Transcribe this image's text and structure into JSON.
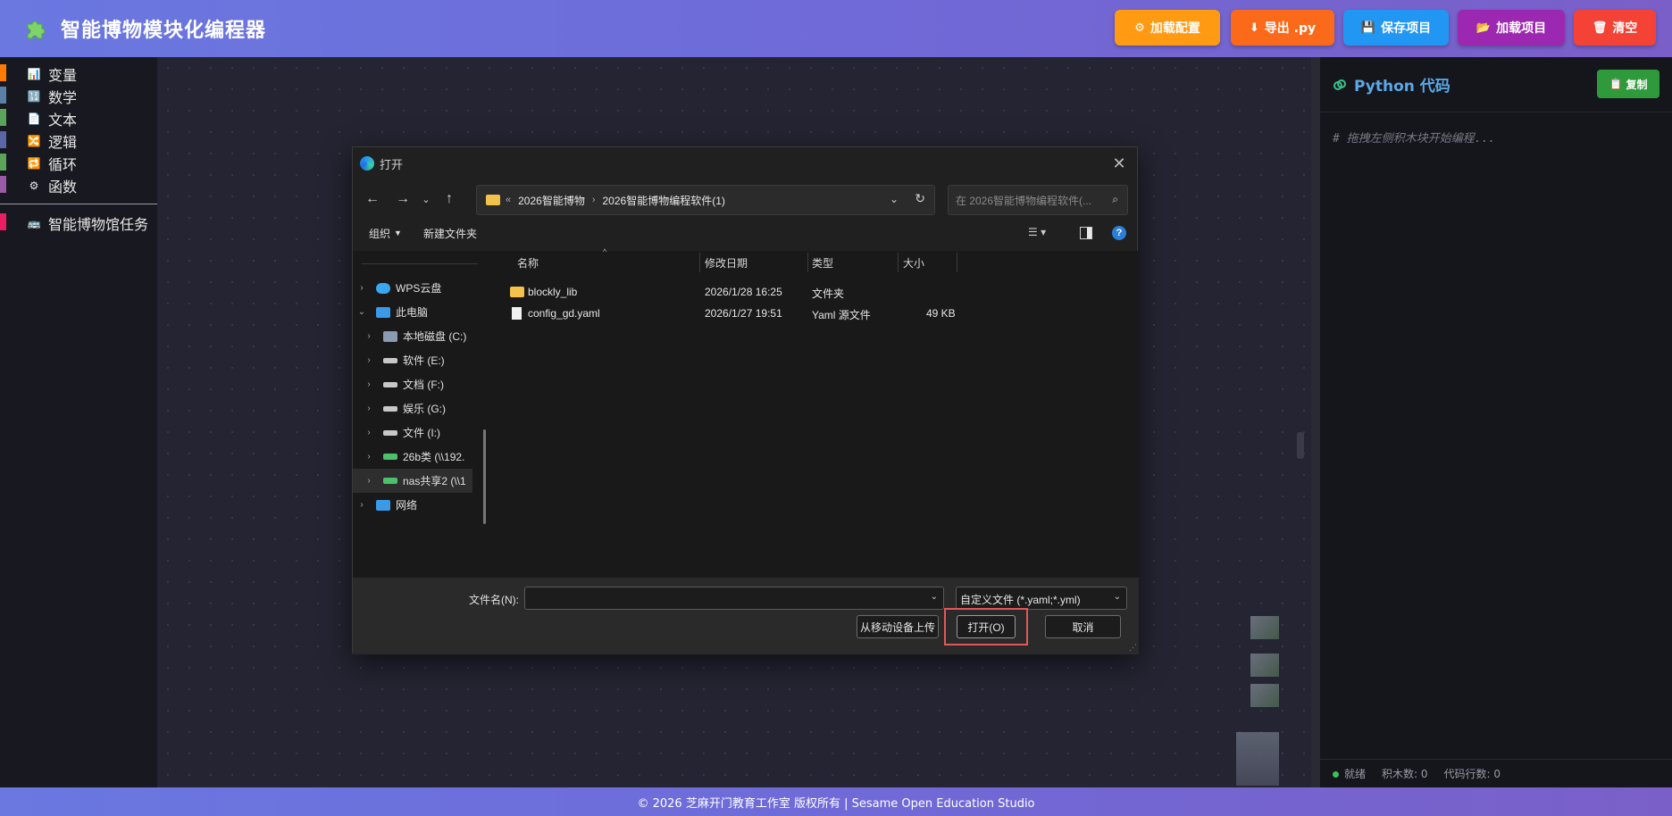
{
  "header": {
    "title": "智能博物模块化编程器",
    "buttons": [
      {
        "label": "加载配置",
        "icon": "⚙",
        "color": "#ff9a12"
      },
      {
        "label": "导出 .py",
        "icon": "⬇",
        "color": "#fb6a1a"
      },
      {
        "label": "保存项目",
        "icon": "💾",
        "color": "#2196f3"
      },
      {
        "label": "加载项目",
        "icon": "📂",
        "color": "#9c27b0"
      },
      {
        "label": "清空",
        "icon": "🗑",
        "color": "#f44336"
      }
    ]
  },
  "sidebar": {
    "categories": [
      {
        "label": "变量",
        "icon": "📊",
        "color": "#ff7a00"
      },
      {
        "label": "数学",
        "icon": "🔢",
        "color": "#5b80a5"
      },
      {
        "label": "文本",
        "icon": "📄",
        "color": "#5ba55b"
      },
      {
        "label": "逻辑",
        "icon": "🔀",
        "color": "#5b67a5"
      },
      {
        "label": "循环",
        "icon": "🔁",
        "color": "#5ba55b"
      },
      {
        "label": "函数",
        "icon": "⚙",
        "color": "#995ba5"
      }
    ],
    "task": {
      "label": "智能博物馆任务",
      "icon": "🚌",
      "color": "#e91e63"
    }
  },
  "code_panel": {
    "title": "Python 代码",
    "copy_label": "复制",
    "comment": "# 拖拽左侧积木块开始编程...",
    "status": "就绪",
    "block_count": "积木数: 0",
    "line_count": "代码行数: 0"
  },
  "footer": {
    "text": "© 2026 芝麻开门教育工作室 版权所有 | Sesame Open Education Studio"
  },
  "dialog": {
    "title": "打开",
    "breadcrumb_prefix": "«",
    "breadcrumb": [
      "2026智能博物",
      "2026智能博物编程软件(1)"
    ],
    "search_placeholder": "在 2026智能博物编程软件(...",
    "toolbar": {
      "organize": "组织",
      "new_folder": "新建文件夹"
    },
    "nav_items": [
      {
        "label": "WPS云盘",
        "indent": 0,
        "expanded": false
      },
      {
        "label": "此电脑",
        "indent": 0,
        "expanded": true
      },
      {
        "label": "本地磁盘 (C:)",
        "indent": 1,
        "expanded": false
      },
      {
        "label": "软件 (E:)",
        "indent": 1,
        "expanded": false
      },
      {
        "label": "文档 (F:)",
        "indent": 1,
        "expanded": false
      },
      {
        "label": "娱乐 (G:)",
        "indent": 1,
        "expanded": false
      },
      {
        "label": "文件 (I:)",
        "indent": 1,
        "expanded": false
      },
      {
        "label": "26b类 (\\\\192.",
        "indent": 1,
        "expanded": false
      },
      {
        "label": "nas共享2 (\\\\1",
        "indent": 1,
        "expanded": false,
        "selected": true
      },
      {
        "label": "网络",
        "indent": 0,
        "expanded": false
      }
    ],
    "columns": {
      "name": "名称",
      "date": "修改日期",
      "type": "类型",
      "size": "大小"
    },
    "files": [
      {
        "name": "blockly_lib",
        "date": "2026/1/28 16:25",
        "type": "文件夹",
        "size": "",
        "kind": "folder"
      },
      {
        "name": "config_gd.yaml",
        "date": "2026/1/27 19:51",
        "type": "Yaml 源文件",
        "size": "49 KB",
        "kind": "file"
      }
    ],
    "filename_label": "文件名(N):",
    "filename_value": "",
    "filetype": "自定义文件 (*.yaml;*.yml)",
    "upload_label": "从移动设备上传",
    "open_label": "打开(O)",
    "cancel_label": "取消"
  }
}
